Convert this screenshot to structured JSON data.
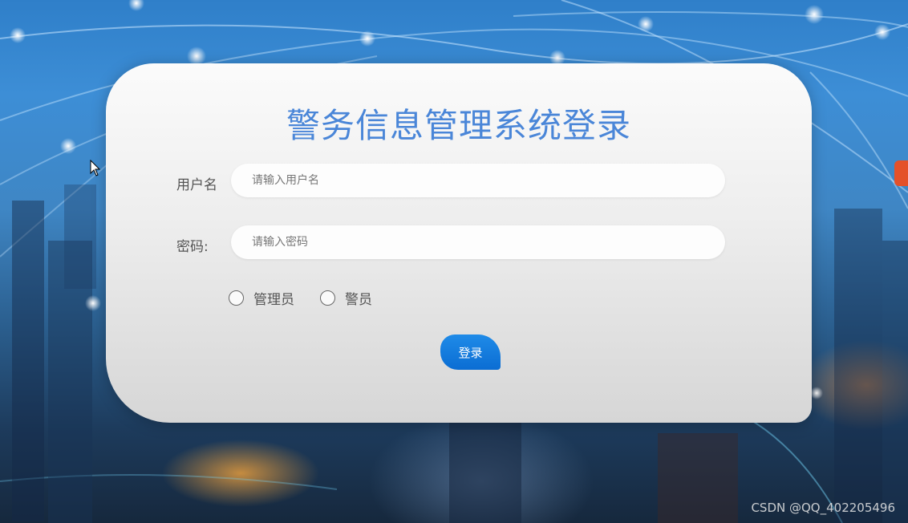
{
  "login": {
    "title": "警务信息管理系统登录",
    "username_label": "用户名",
    "username_placeholder": "请输入用户名",
    "username_value": "",
    "password_label": "密码:",
    "password_placeholder": "请输入密码",
    "password_value": "",
    "roles": [
      {
        "label": "管理员",
        "selected": false
      },
      {
        "label": "警员",
        "selected": false
      }
    ],
    "submit_label": "登录"
  },
  "watermark": "CSDN @QQ_402205496",
  "colors": {
    "title": "#4a86d8",
    "button": "#0b6dd3",
    "card": "#ededed"
  }
}
